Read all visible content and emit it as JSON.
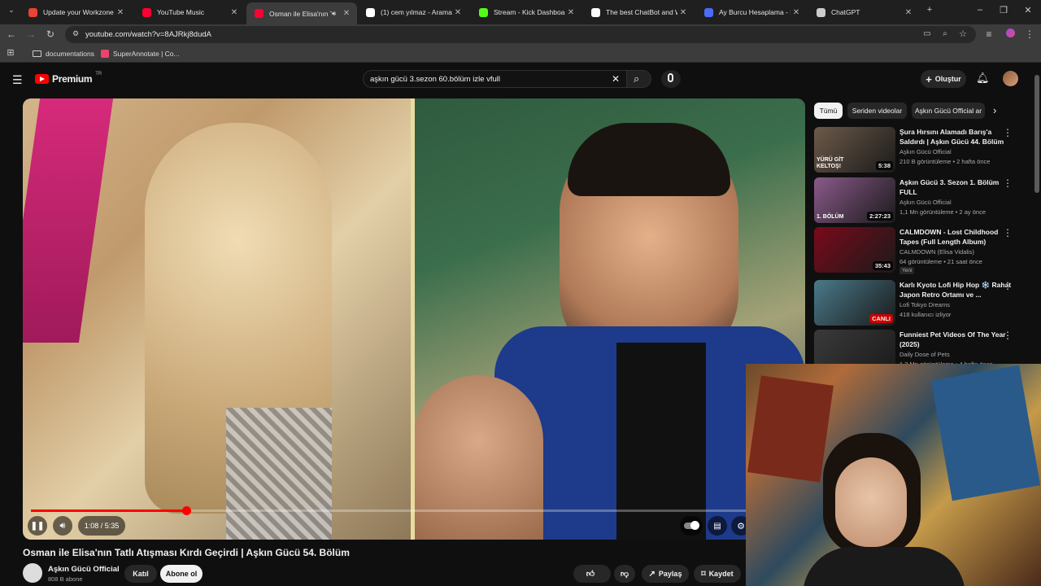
{
  "browser": {
    "tabs": [
      {
        "title": "Update your Workzone p",
        "favicon_color": "#ea4335",
        "icon": "gmail-icon"
      },
      {
        "title": "YouTube Music",
        "favicon_color": "#ff0033",
        "icon": "youtube-music-icon"
      },
      {
        "title": "Osman ile Elisa'nın Ta",
        "favicon_color": "#ff0033",
        "icon": "youtube-icon",
        "active": true
      },
      {
        "title": "(1) cem yılmaz - Arama /",
        "favicon_color": "#ffffff",
        "icon": "x-icon"
      },
      {
        "title": "Stream - Kick Dashboard",
        "favicon_color": "#53fc18",
        "icon": "kick-icon"
      },
      {
        "title": "The best ChatBot and W",
        "favicon_color": "#ffffff",
        "icon": "chatbot-icon"
      },
      {
        "title": "Ay Burcu Hesaplama - H",
        "favicon_color": "#4a6cf7",
        "icon": "h-icon"
      },
      {
        "title": "ChatGPT",
        "favicon_color": "#cccccc",
        "icon": "chatgpt-icon"
      }
    ],
    "url": "youtube.com/watch?v=8AJRkj8dudA",
    "bookmarks": [
      {
        "label": "documentations",
        "icon": "folder-icon"
      },
      {
        "label": "SuperAnnotate | Co...",
        "icon": "superannotate-icon"
      }
    ]
  },
  "youtube": {
    "logo_text": "Premium",
    "logo_sup": "TR",
    "search_query": "aşkın gücü 3.sezon 60.bölüm izle vfull",
    "create_label": "Oluştur",
    "player": {
      "time": "1:08 / 5:35",
      "progress": 0.203
    },
    "video_title": "Osman ile Elisa'nın Tatlı Atışması Kırdı Geçirdi | Aşkın Gücü 54. Bölüm",
    "channel": {
      "name": "Aşkın Gücü Official",
      "subscribers": "808 B abone",
      "join_label": "Katıl",
      "subscribe_label": "Abone ol"
    },
    "actions": {
      "likes": "882",
      "share_label": "Paylaş",
      "save_label": "Kaydet"
    },
    "chips": [
      "Tümü",
      "Seriden videolar",
      "Aşkın Gücü Official ar"
    ],
    "recommendations": [
      {
        "title": "Şura Hırsını Alamadı Barış'a Saldırdı | Aşkın Gücü 44. Bölüm",
        "channel": "Aşkın Gücü Official",
        "meta": "210 B görüntüleme • 2 hafta önce",
        "duration": "5:38",
        "thumb_color": "#6d5a4a",
        "overlay": "YÜRÜ GİT KELTOŞ!"
      },
      {
        "title": "Aşkın Gücü 3. Sezon 1. Bölüm FULL",
        "channel": "Aşkın Gücü Official",
        "meta": "1,1 Mn görüntüleme • 2 ay önce",
        "duration": "2:27:23",
        "thumb_color": "#8a5a8a",
        "overlay": "1. BÖLÜM"
      },
      {
        "title": "CALMDOWN - Lost Childhood Tapes (Full Length Album)",
        "channel": "CALMDOWN (Elisa Vidalis)",
        "meta": "64 görüntüleme • 21 saat önce",
        "duration": "35:43",
        "thumb_color": "#7a0a1a",
        "badge": "Yeni"
      },
      {
        "title": "Karlı Kyoto Lofi Hip Hop ❄️ Rahat Japon Retro Ortamı ve ...",
        "channel": "Lofi Tokyo Dreams",
        "meta": "418 kullanıcı izliyor",
        "duration": "CANLI",
        "thumb_color": "#4a7a8a"
      },
      {
        "title": "Funniest Pet Videos Of The Year (2025)",
        "channel": "Daily Dose of Pets",
        "meta": "1,3 Mn görüntüleme • 4 hafta önce",
        "duration": "",
        "thumb_color": "#3a3a3a"
      }
    ]
  }
}
